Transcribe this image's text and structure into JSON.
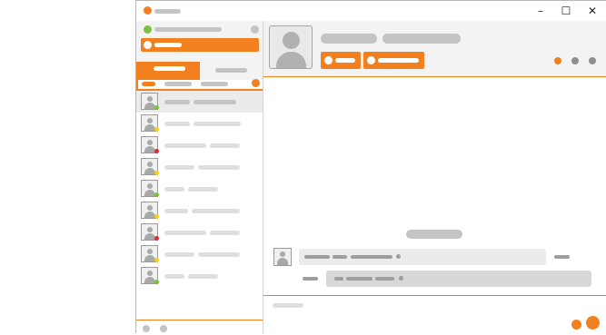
{
  "colors": {
    "accent": "#f2801f",
    "online": "#7cc043",
    "away": "#f5d11e",
    "busy": "#e02a2a",
    "placeholder": "#c4c4c4"
  },
  "window": {
    "controls": {
      "minimize": "–",
      "maximize": "☐",
      "close": "✕"
    }
  },
  "sidebar": {
    "contacts": [
      {
        "status": "online"
      },
      {
        "status": "away"
      },
      {
        "status": "busy"
      },
      {
        "status": "away"
      },
      {
        "status": "online"
      },
      {
        "status": "away"
      },
      {
        "status": "busy"
      },
      {
        "status": "away"
      },
      {
        "status": "online"
      }
    ]
  },
  "icons": [
    "user-avatar-icon",
    "status-dot-icon",
    "minimize-icon",
    "maximize-icon",
    "close-icon"
  ]
}
